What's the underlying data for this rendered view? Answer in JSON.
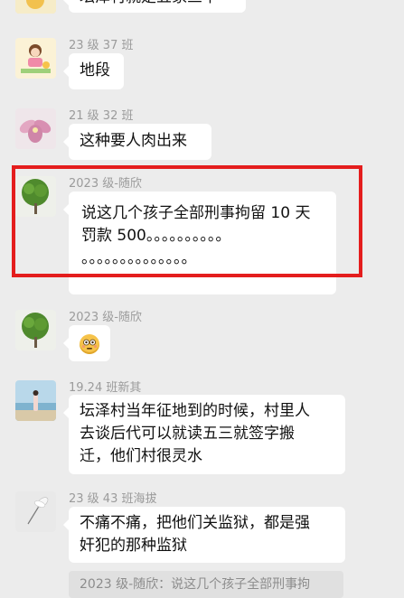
{
  "messages": [
    {
      "id": "m0",
      "sender": "",
      "text": "坛泽村就是五家三中"
    },
    {
      "id": "m1",
      "sender": "23 级 37 班",
      "text": "地段"
    },
    {
      "id": "m2",
      "sender": "21 级 32 班",
      "text": "这种要人肉出来"
    },
    {
      "id": "m3",
      "sender": "2023 级-随欣",
      "text": "说这几个孩子全部刑事拘留 10 天\n罚款 500。。。。。。。。。。\n。。。。。。。。。。。。。。"
    },
    {
      "id": "m4",
      "sender": "2023 级-随欣",
      "emoji": "flushed-face"
    },
    {
      "id": "m5",
      "sender": "19.24 班新其",
      "text": "坛泽村当年征地到的时候，村里人\n去谈后代可以就读五三就签字搬\n迁，他们村很灵水"
    },
    {
      "id": "m6",
      "sender": "23 级 43 班海拔",
      "text": "不痛不痛，把他们关监狱，都是强\n奸犯的那种监狱"
    }
  ],
  "quote": {
    "text": "2023 级-随欣：说这几个孩子全部刑事拘"
  },
  "colors": {
    "highlight": "#e41d1d",
    "bubble": "#ffffff",
    "background": "#ececec"
  }
}
